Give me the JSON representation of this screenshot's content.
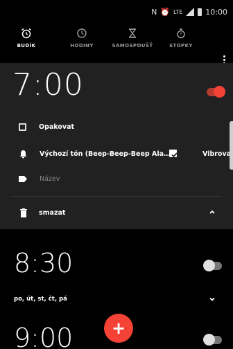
{
  "status_bar": {
    "time": "10:00",
    "network": "LTE",
    "icons": [
      "nfc-icon",
      "alarm-icon",
      "network-icon",
      "signal-icon",
      "battery-icon"
    ]
  },
  "tabs": [
    {
      "label": "BUDÍK",
      "icon": "alarm-clock-icon",
      "active": true
    },
    {
      "label": "HODINY",
      "icon": "clock-icon",
      "active": false
    },
    {
      "label": "SAMOSPOUŠŤ",
      "icon": "hourglass-icon",
      "active": false
    },
    {
      "label": "STOPKY",
      "icon": "stopwatch-icon",
      "active": false
    }
  ],
  "alarms": [
    {
      "time": "7:00",
      "enabled": true,
      "expanded": true,
      "repeat_label": "Opakovat",
      "repeat_checked": false,
      "ringtone": "Výchozí tón (Beep-Beep-Beep Ala…",
      "vibrate_label": "Vibrovat",
      "vibrate_checked": true,
      "label_placeholder": "Název",
      "delete_label": "smazat"
    },
    {
      "time": "8:30",
      "enabled": false,
      "expanded": false,
      "days": "po, út, st, čt, pá"
    },
    {
      "time": "9:00",
      "enabled": false,
      "expanded": false
    }
  ],
  "fab": {
    "label": "+"
  },
  "colors": {
    "accent": "#f44336",
    "card_bg": "#212121",
    "background": "#000000"
  }
}
